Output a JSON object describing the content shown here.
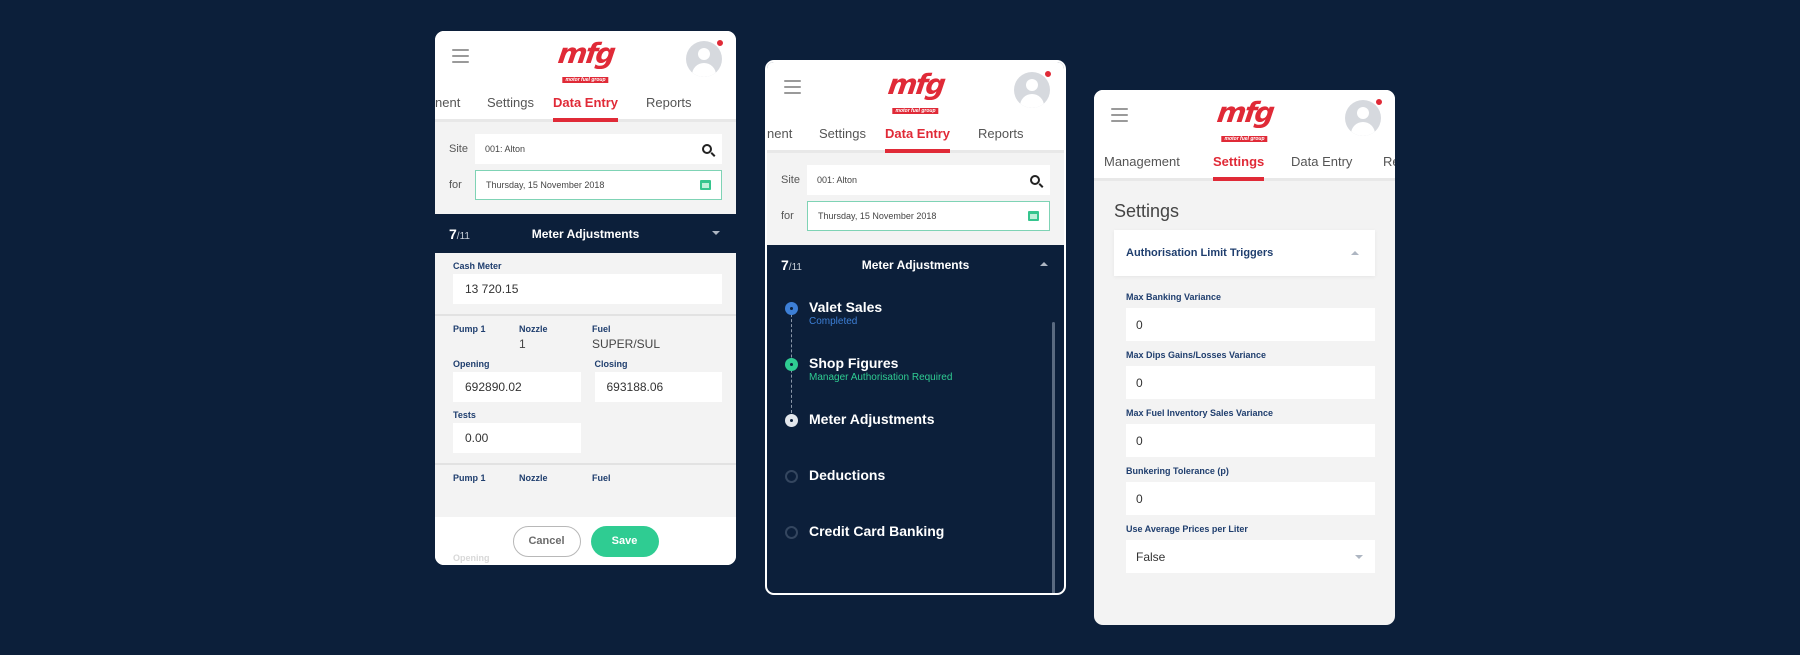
{
  "brand": {
    "logo_text": "mfg",
    "tagline": "motor fuel group",
    "accent": "#e02a37",
    "navy": "#0c1f3a",
    "green": "#2fcc92",
    "blue": "#3d7fd6"
  },
  "phone1": {
    "tabs": [
      "nent",
      "Settings",
      "Data Entry",
      "Reports"
    ],
    "active_tab": "Data Entry",
    "site_label": "Site",
    "site_value": "001: Alton",
    "for_label": "for",
    "date_value": "Thursday, 15 November 2018",
    "step": {
      "current": "7",
      "total": "/11",
      "title": "Meter Adjustments"
    },
    "cash_meter": {
      "label": "Cash Meter",
      "value": "13 720.15"
    },
    "pump_block": {
      "pump_label": "Pump 1",
      "nozzle_label": "Nozzle",
      "nozzle_value": "1",
      "fuel_label": "Fuel",
      "fuel_value": "SUPER/SUL",
      "opening_label": "Opening",
      "opening_value": "692890.02",
      "closing_label": "Closing",
      "closing_value": "693188.06",
      "tests_label": "Tests",
      "tests_value": "0.00"
    },
    "pump_block2": {
      "pump_label": "Pump 1",
      "nozzle_label": "Nozzle",
      "fuel_label": "Fuel",
      "opening_label": "Opening"
    },
    "cancel_label": "Cancel",
    "save_label": "Save"
  },
  "phone2": {
    "tabs": [
      "nent",
      "Settings",
      "Data Entry",
      "Reports"
    ],
    "active_tab": "Data Entry",
    "site_label": "Site",
    "site_value": "001: Alton",
    "for_label": "for",
    "date_value": "Thursday, 15 November 2018",
    "step": {
      "current": "7",
      "total": "/11",
      "title": "Meter Adjustments"
    },
    "steps": [
      {
        "title": "Valet Sales",
        "status": "Completed",
        "state": "completed"
      },
      {
        "title": "Shop Figures",
        "status": "Manager Authorisation Required",
        "state": "auth"
      },
      {
        "title": "Meter Adjustments",
        "status": "",
        "state": "current"
      },
      {
        "title": "Deductions",
        "status": "",
        "state": "pending"
      },
      {
        "title": "Credit Card Banking",
        "status": "",
        "state": "pending"
      }
    ]
  },
  "phone3": {
    "tabs": [
      "Management",
      "Settings",
      "Data Entry",
      "Re"
    ],
    "active_tab": "Settings",
    "page_title": "Settings",
    "section_title": "Authorisation Limit Triggers",
    "fields": [
      {
        "label": "Max Banking Variance",
        "value": "0"
      },
      {
        "label": "Max Dips Gains/Losses Variance",
        "value": "0"
      },
      {
        "label": "Max Fuel Inventory Sales Variance",
        "value": "0"
      },
      {
        "label": "Bunkering Tolerance (p)",
        "value": "0"
      },
      {
        "label": "Use Average Prices per Liter",
        "value": "False",
        "type": "select"
      }
    ]
  }
}
